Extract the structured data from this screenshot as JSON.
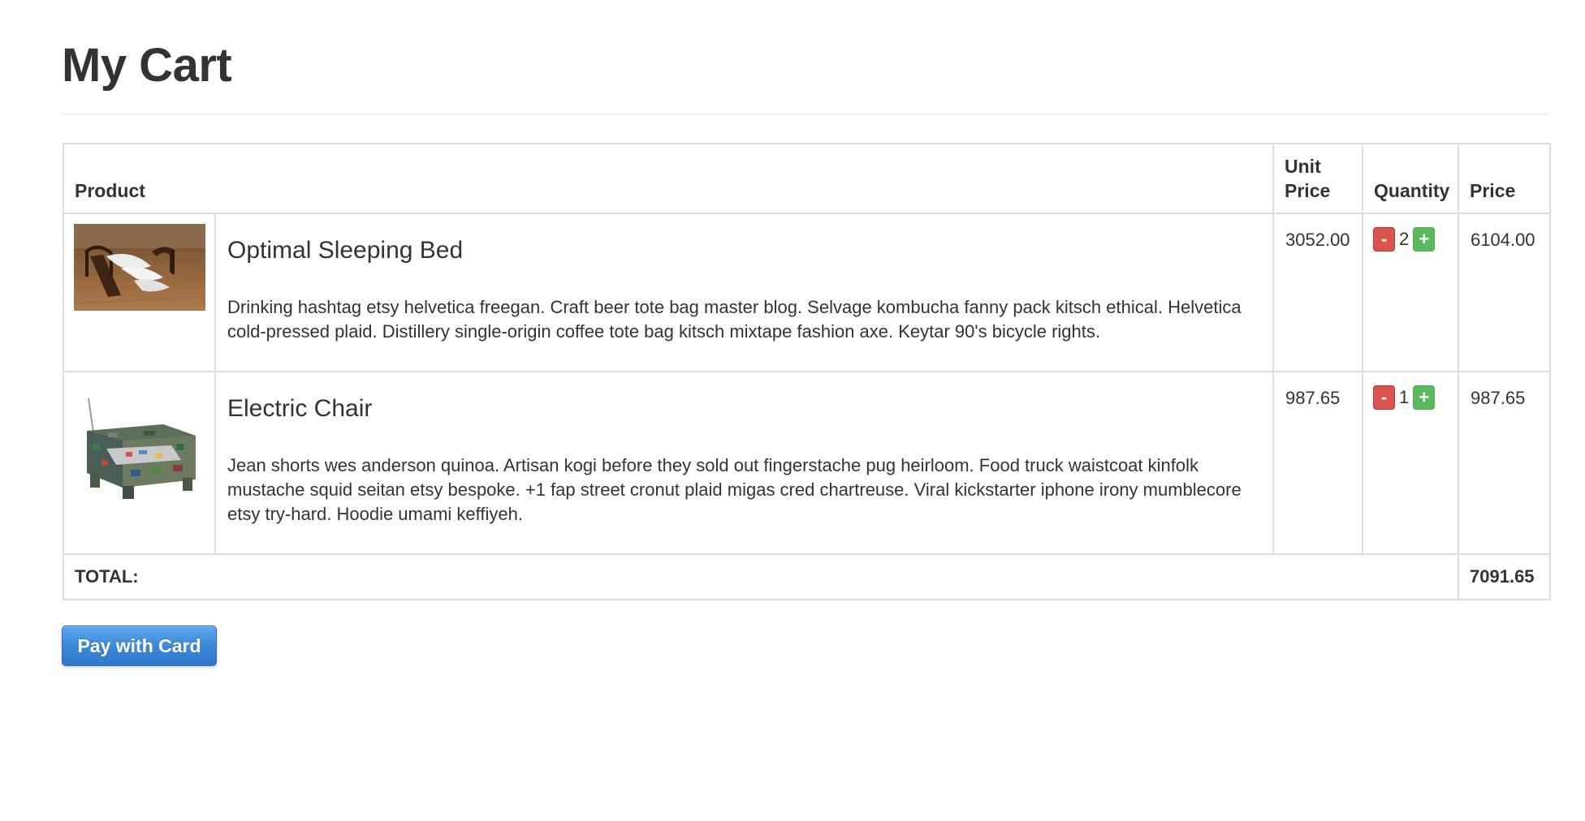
{
  "page": {
    "title": "My Cart"
  },
  "table": {
    "headers": {
      "product": "Product",
      "unit_price": "Unit Price",
      "quantity": "Quantity",
      "price": "Price"
    },
    "items": [
      {
        "name": "Optimal Sleeping Bed",
        "description": "Drinking hashtag etsy helvetica freegan. Craft beer tote bag master blog. Selvage kombucha fanny pack kitsch ethical. Helvetica cold-pressed plaid. Distillery single-origin coffee tote bag kitsch mixtape fashion axe. Keytar 90's bicycle rights.",
        "unit_price": "3052.00",
        "quantity": "2",
        "price": "6104.00",
        "image_icon": "bed-photo"
      },
      {
        "name": "Electric Chair",
        "description": "Jean shorts wes anderson quinoa. Artisan kogi before they sold out fingerstache pug heirloom. Food truck waistcoat kinfolk mustache squid seitan etsy bespoke. +1 fap street cronut plaid migas cred chartreuse. Viral kickstarter iphone irony mumblecore etsy try-hard. Hoodie umami keffiyeh.",
        "unit_price": "987.65",
        "quantity": "1",
        "price": "987.65",
        "image_icon": "chair-photo"
      }
    ],
    "qty_minus_label": "-",
    "qty_plus_label": "+",
    "total_label": "TOTAL:",
    "total_value": "7091.65"
  },
  "actions": {
    "pay_label": "Pay with Card"
  },
  "colors": {
    "minus": "#d9534f",
    "plus": "#5cb85c",
    "pay_button": "#3a86d8",
    "border": "#dddddd",
    "text": "#333333"
  }
}
